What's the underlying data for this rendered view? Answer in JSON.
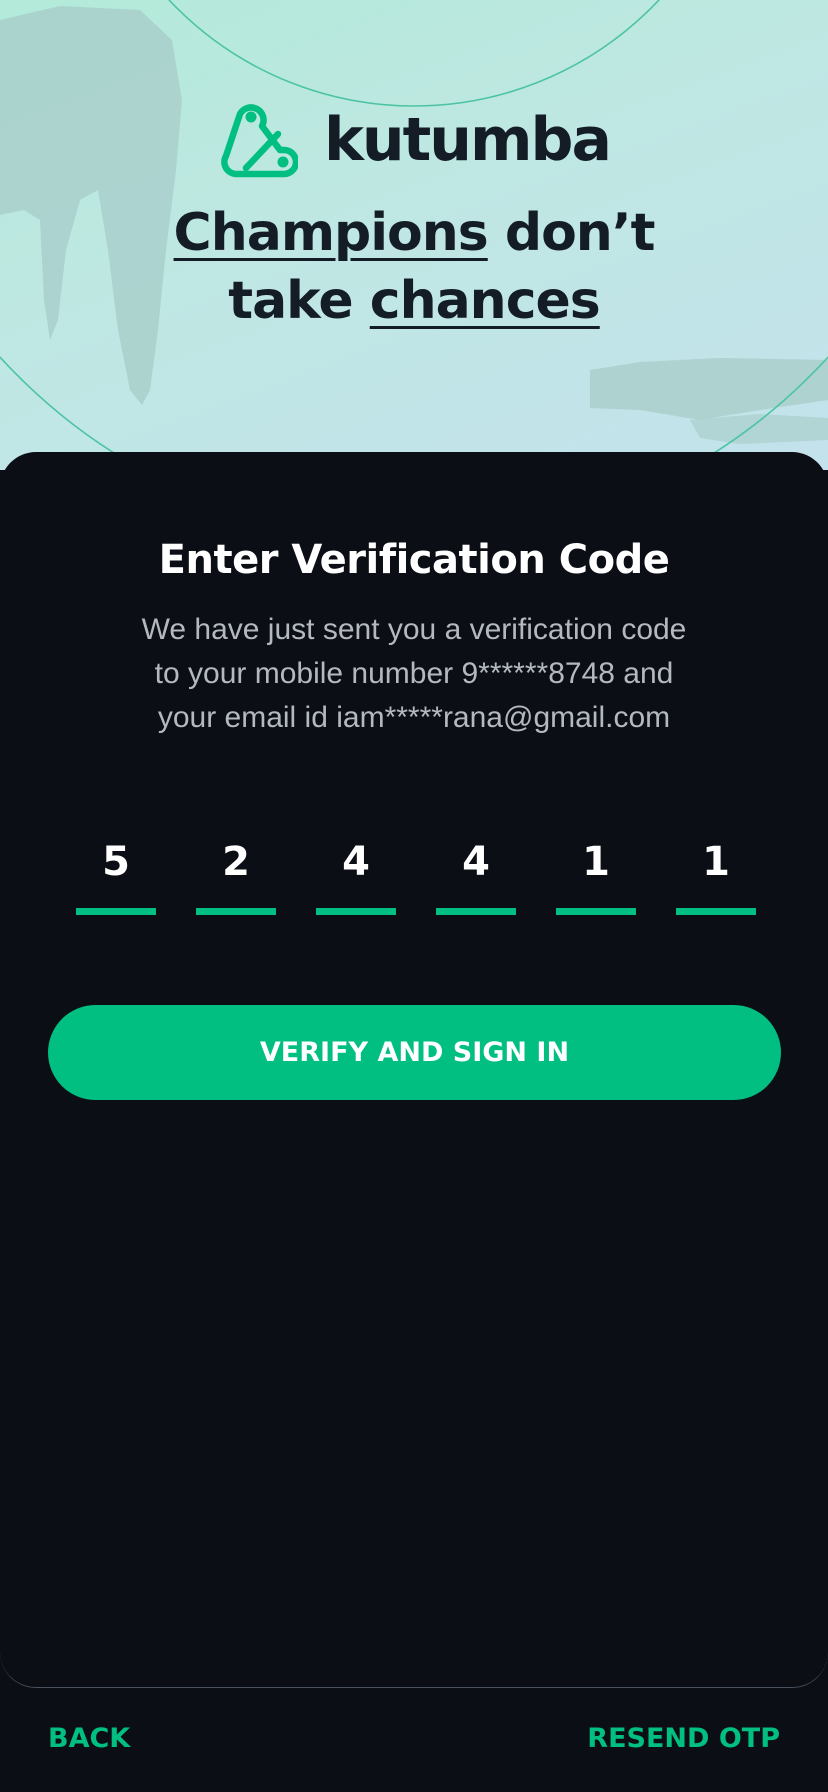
{
  "brand": {
    "name": "kutumba",
    "logo_icon": "kutumba-logo-icon"
  },
  "hero": {
    "tagline_line1": [
      "Champions",
      " don’t"
    ],
    "tagline_line2": [
      "take ",
      "chances"
    ]
  },
  "verification": {
    "title": "Enter Verification Code",
    "message_lines": [
      "We have just sent you a verification code",
      "to your mobile number 9******8748 and",
      "your email id iam*****rana@gmail.com"
    ],
    "otp_digits": [
      "5",
      "2",
      "4",
      "4",
      "1",
      "1"
    ],
    "verify_button_label": "VERIFY AND SIGN IN"
  },
  "footer": {
    "back_label": "BACK",
    "resend_label": "RESEND OTP"
  },
  "colors": {
    "accent": "#00bf80",
    "background": "#0b0f15",
    "hero_bg": "#b3ead9",
    "text_dark": "#141c26"
  }
}
